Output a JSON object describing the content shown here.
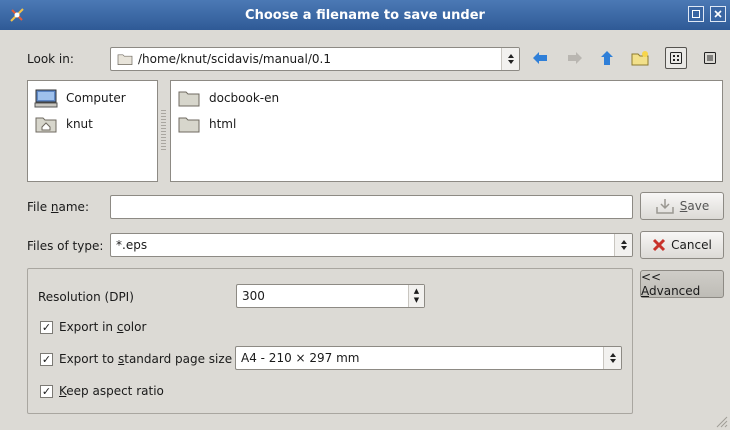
{
  "window": {
    "title": "Choose a filename to save under"
  },
  "lookin": {
    "label": "Look in:",
    "path": "/home/knut/scidavis/manual/0.1"
  },
  "places": [
    {
      "label": "Computer",
      "icon": "computer-icon"
    },
    {
      "label": "knut",
      "icon": "home-folder-icon"
    }
  ],
  "files": [
    {
      "label": "docbook-en",
      "icon": "folder-icon"
    },
    {
      "label": "html",
      "icon": "folder-icon"
    }
  ],
  "filename": {
    "label_pre": "File ",
    "label_key": "n",
    "label_post": "ame:",
    "value": ""
  },
  "filetype": {
    "label": "Files of type:",
    "value": "*.eps"
  },
  "buttons": {
    "save_key": "S",
    "save_rest": "ave",
    "cancel": "Cancel",
    "advanced_pre": "<< ",
    "advanced_key": "A",
    "advanced_rest": "dvanced"
  },
  "options": {
    "resolution_label": "Resolution (DPI)",
    "resolution_value": "300",
    "color_pre": "Export in ",
    "color_key": "c",
    "color_post": "olor",
    "pagesize_pre": "Export to ",
    "pagesize_key": "s",
    "pagesize_post": "tandard page size",
    "pagesize_value": "A4 - 210 × 297 mm",
    "aspect_key": "K",
    "aspect_post": "eep aspect ratio"
  },
  "colors": {
    "titlebar": "#3b6aa8",
    "accent_arrow": "#2f7fd8"
  }
}
